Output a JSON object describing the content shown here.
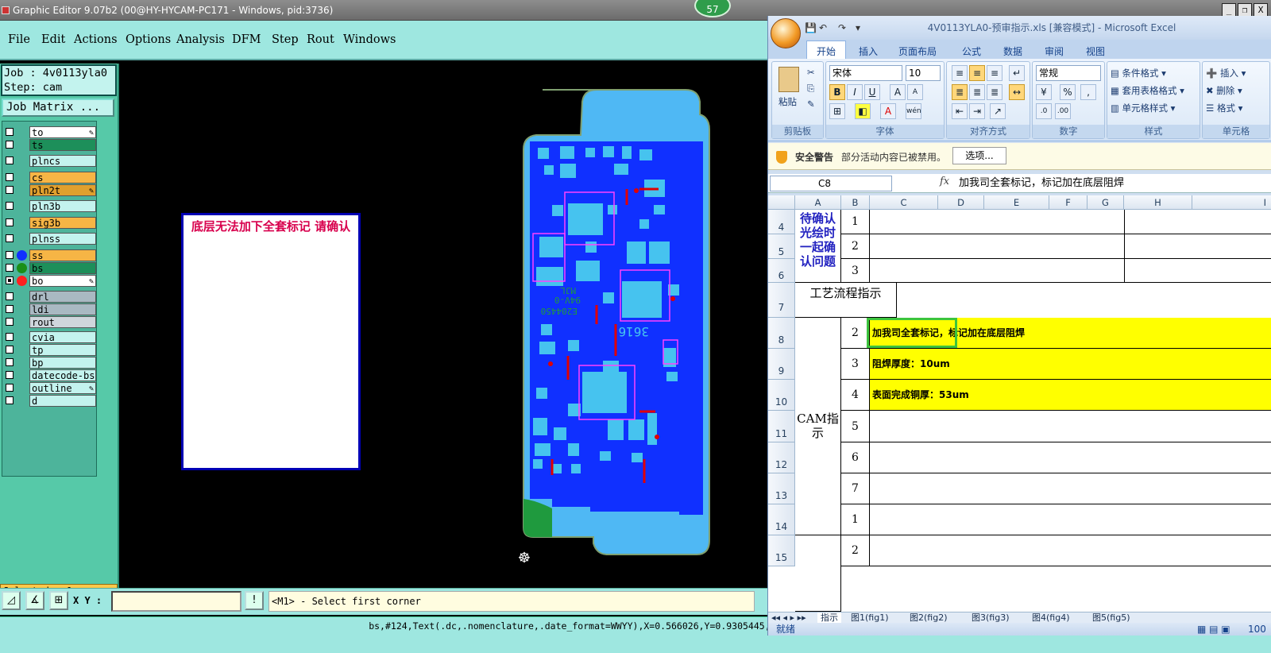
{
  "ge": {
    "title": "Graphic Editor 9.07b2 (00@HY-HYCAM-PC171 - Windows, pid:3736)",
    "badge": "57",
    "menu": [
      "File",
      "Edit",
      "Actions",
      "Options",
      "Analysis",
      "DFM",
      "Step",
      "Rout",
      "Windows"
    ],
    "job_line": "Job : 4v0113yla0",
    "step_line": "Step: cam",
    "job_matrix": "Job Matrix ...",
    "layers": [
      {
        "name": "to",
        "bg": "#ffffff",
        "dot": "",
        "pen": true
      },
      {
        "name": "ts",
        "bg": "#1d8f5a",
        "dot": "",
        "pen": false
      },
      {
        "name": "plncs",
        "bg": "#c3f3ee",
        "dot": "",
        "pen": false
      },
      {
        "name": "cs",
        "bg": "#f6b545",
        "dot": "",
        "pen": false
      },
      {
        "name": "pln2t",
        "bg": "#e0a02e",
        "dot": "",
        "pen": true
      },
      {
        "name": "pln3b",
        "bg": "#c3f3ee",
        "dot": "",
        "pen": false
      },
      {
        "name": "sig3b",
        "bg": "#f6b545",
        "dot": "",
        "pen": false
      },
      {
        "name": "plnss",
        "bg": "#c3f3ee",
        "dot": "",
        "pen": false
      },
      {
        "name": "ss",
        "bg": "#f6b545",
        "dot": "#1030ff",
        "pen": false
      },
      {
        "name": "bs",
        "bg": "#1d8f5a",
        "dot": "#1a8f18",
        "pen": false
      },
      {
        "name": "bo",
        "bg": "#ffffff",
        "dot": "#ff2020",
        "pen": true
      },
      {
        "name": "drl",
        "bg": "#a9b9c2",
        "dot": "",
        "pen": false
      },
      {
        "name": "ldi",
        "bg": "#a9b9c2",
        "dot": "",
        "pen": false
      },
      {
        "name": "rout",
        "bg": "#cfd6dc",
        "dot": "",
        "pen": false
      },
      {
        "name": "cvia",
        "bg": "#c3f3ee",
        "dot": "",
        "pen": false
      },
      {
        "name": "tp",
        "bg": "#c3f3ee",
        "dot": "",
        "pen": false
      },
      {
        "name": "bp",
        "bg": "#c3f3ee",
        "dot": "",
        "pen": false
      },
      {
        "name": "datecode-bs",
        "bg": "#c3f3ee",
        "dot": "",
        "pen": false
      },
      {
        "name": "outline",
        "bg": "#c3f3ee",
        "dot": "",
        "pen": true
      },
      {
        "name": "d",
        "bg": "#c3f3ee",
        "dot": "",
        "pen": false
      }
    ],
    "selected": "Selected : 0",
    "message": "底层无法加下全套标记 请确认",
    "pcb_marking": [
      "MJL",
      "94V-0",
      "E204450",
      "3616"
    ],
    "xy_label": "X Y :",
    "xy_value": "",
    "prompt": "<M1> - Select first corner",
    "status_line": "bs,#124,Text(.dc,.nomenclature,.date_format=WWYY),X=0.566026,Y=0.9305445,3616,POS,datecode,Mirror"
  },
  "xl": {
    "title": "4V0113YLA0-预审指示.xls [兼容模式] - Microsoft Excel",
    "tabs": [
      "开始",
      "插入",
      "页面布局",
      "公式",
      "数据",
      "审阅",
      "视图"
    ],
    "ribbon": {
      "paste": "粘贴",
      "clipboard": "剪贴板",
      "font_name": "宋体",
      "font_size": "10",
      "font_group": "字体",
      "align_group": "对齐方式",
      "number_format": "常规",
      "number_group": "数字",
      "cond_format": "条件格式",
      "table_format": "套用表格格式",
      "cell_style": "单元格样式",
      "styles_group": "样式",
      "insert": "插入",
      "delete": "删除",
      "format": "格式",
      "cells_group": "单元格"
    },
    "security": {
      "title": "安全警告",
      "text": "部分活动内容已被禁用。",
      "button": "选项..."
    },
    "name_box": "C8",
    "formula": "加我司全套标记，标记加在底层阻焊",
    "columns": [
      "A",
      "B",
      "C",
      "D",
      "E",
      "F",
      "G",
      "H",
      "I"
    ],
    "rows": [
      "4",
      "5",
      "6",
      "7",
      "8",
      "9",
      "10",
      "11",
      "12",
      "13",
      "14",
      "15"
    ],
    "confirm_label": "待确认光绘时一起确认问题",
    "process_label": "工艺流程指示",
    "cam_label": "CAM指示",
    "b_values": [
      "1",
      "2",
      "3",
      "1",
      "2",
      "3",
      "4",
      "5",
      "6",
      "7",
      "1",
      "2"
    ],
    "cam_rows": [
      "加我司全套标记，标记加在底层阻焊",
      "阻焊厚度：10um",
      "表面完成铜厚：53um"
    ],
    "sheets": [
      "指示",
      "图1(fig1)",
      "图2(fig2)",
      "图3(fig3)",
      "图4(fig4)",
      "图5(fig5)"
    ],
    "status": "就绪",
    "zoom": "100"
  },
  "colors": {
    "pcb_dark": "#1030ff",
    "pcb_light": "#4fb8f4",
    "pad": "#46c3ef",
    "trace_red": "#e00000",
    "magenta": "#ff40ff",
    "silk": "#1f9a3e"
  }
}
